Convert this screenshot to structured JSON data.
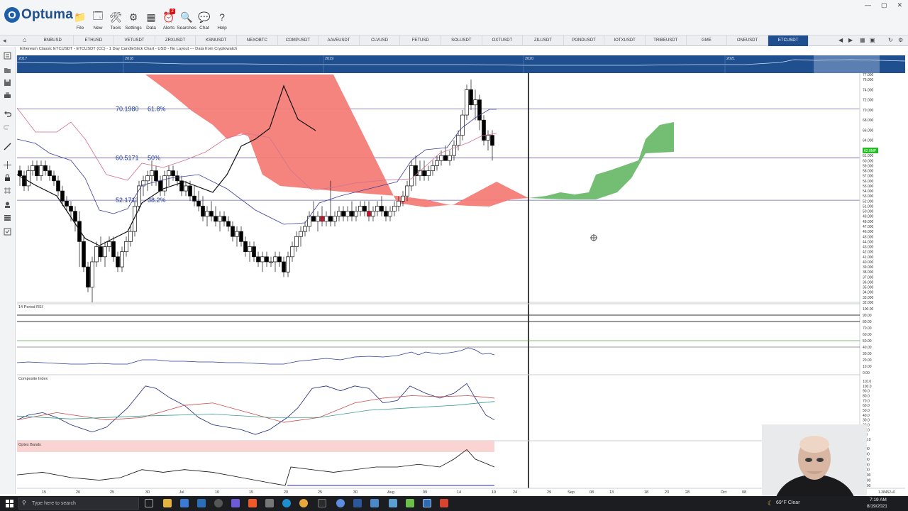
{
  "app": {
    "name": "Optuma",
    "logo_letter": "O"
  },
  "toolbar": [
    {
      "label": "File",
      "icon": "folder-icon"
    },
    {
      "label": "New",
      "icon": "new-window-icon"
    },
    {
      "label": "Tools",
      "icon": "tools-icon"
    },
    {
      "label": "Settings",
      "icon": "gear-icon"
    },
    {
      "label": "Data",
      "icon": "data-icon"
    },
    {
      "label": "Alerts",
      "icon": "alarm-clock-icon",
      "badge": "2"
    },
    {
      "label": "Searches",
      "icon": "search-icon"
    },
    {
      "label": "Chat",
      "icon": "chat-icon"
    },
    {
      "label": "Help",
      "icon": "help-icon"
    }
  ],
  "tabs": [
    "BNBUSD",
    "ETHUSD",
    "VETUSDT",
    "ZRXUSDT",
    "KSMUSDT",
    "NEXOBTC",
    "COMPUSDT",
    "AAVEUSDT",
    "CLVUSD",
    "FETUSD",
    "SOLUSDT",
    "OXTUSDT",
    "ZILUSDT",
    "PONDUSDT",
    "IOTXUSDT",
    "TRIBEUSDT",
    "GME",
    "ONEUSDT",
    "ETCUSDT"
  ],
  "active_tab": "ETCUSDT",
  "chart": {
    "title": "Ethereum Classic ETCUSDT - ETCUSDT (CC) - 1 Day CandleStick Chart - USD - No Layout --- Data from Cryptowatch",
    "overview_years": [
      "2017",
      "2018",
      "2019",
      "2020",
      "2021"
    ],
    "fib_levels": [
      {
        "value": "70.1980",
        "pct": "61.8%",
        "price": 70.198
      },
      {
        "value": "60.5171",
        "pct": "50%",
        "price": 60.517
      },
      {
        "value": "52.1713",
        "pct": "38.2%",
        "price": 52.171
      }
    ],
    "price_axis": [
      "77.000",
      "76.000",
      "74.000",
      "72.000",
      "70.000",
      "68.000",
      "66.000",
      "64.000",
      "62.000",
      "61.000",
      "60.000",
      "59.000",
      "58.000",
      "57.000",
      "56.000",
      "55.000",
      "54.000",
      "53.000",
      "52.000",
      "51.000",
      "50.000",
      "49.000",
      "48.000",
      "47.000",
      "46.000",
      "45.000",
      "44.000",
      "43.000",
      "42.000",
      "41.000",
      "40.000",
      "39.000",
      "38.000",
      "37.000",
      "36.000",
      "35.000",
      "34.000",
      "33.000",
      "32.000"
    ],
    "last_price_tag": "62.0MP",
    "x_axis": [
      "15",
      "20",
      "25",
      "30",
      "Jul",
      "10",
      "15",
      "20",
      "25",
      "30",
      "Aug",
      "09",
      "14",
      "19",
      "24",
      "29",
      "Sep",
      "08",
      "13",
      "18",
      "23",
      "28",
      "Oct",
      "08"
    ],
    "crosshair_readout": "1.38452+0",
    "colors": {
      "bear_cloud": "#f47a74",
      "bull_cloud": "#6cbb6a",
      "accent": "#1f4f8f",
      "badge_green": "#22bb22"
    }
  },
  "panels": [
    {
      "title": "14 Period RSI",
      "axis": [
        "100.00",
        "90.00",
        "80.00",
        "70.00",
        "60.00",
        "50.00",
        "40.00",
        "30.00",
        "20.00",
        "10.00",
        "0.00"
      ]
    },
    {
      "title": "Composite Index",
      "axis": [
        "110.0",
        "100.0",
        "90.0",
        "80.0",
        "70.0",
        "60.0",
        "50.0",
        "40.0",
        "30.0",
        "20.0",
        "10.0",
        "0.0",
        "-10.0"
      ]
    },
    {
      "title": "Optex Bands",
      "axis": [
        "4.00",
        "3.00",
        "2.00",
        "1.00",
        "0.00",
        "-1.00",
        "-2.00",
        "-3.00"
      ]
    }
  ],
  "taskbar": {
    "search_placeholder": "Type here to search",
    "weather": "69°F Clear",
    "time": "7:19 AM",
    "date": "8/19/2021"
  }
}
